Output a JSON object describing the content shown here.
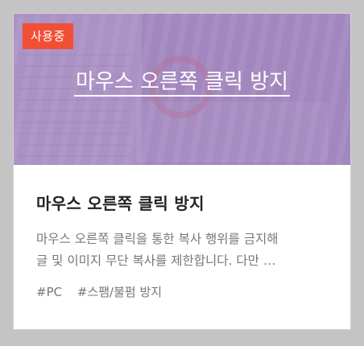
{
  "card": {
    "badge": "사용중",
    "hero_title": "마우스 오른쪽 클릭 방지",
    "title": "마우스 오른쪽 클릭 방지",
    "description": "마우스 오른쪽 클릭을 통한 복사 행위를 금지해\n글 및 이미지 무단 복사를 제한합니다. 다만 …",
    "tags": [
      "#PC",
      "#스팸/불펌 방지"
    ]
  },
  "colors": {
    "badge_bg": "#f24e34",
    "hero_overlay": "#a082be",
    "background": "#c4c4c4"
  }
}
